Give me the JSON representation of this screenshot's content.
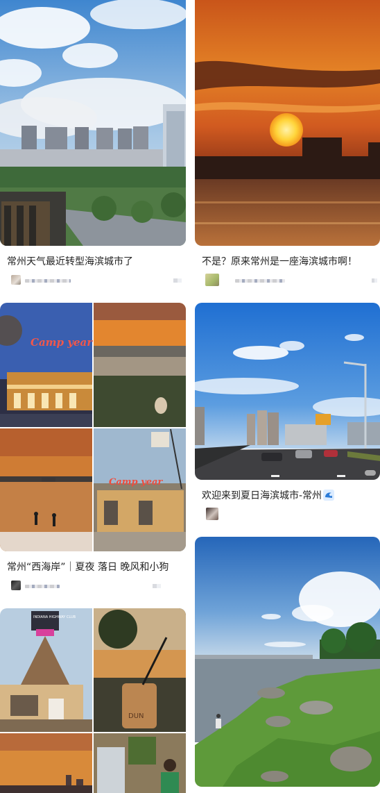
{
  "feed": {
    "left": [
      {
        "title": "常州天气最近转型海滨城市了",
        "image": "city-skyline-cloudy-sky-photo"
      },
      {
        "title": "常州“西海岸”｜夏夜 落日 晚风和小狗",
        "image": "collage-camp-yeah-sunset-dog-wakeboard",
        "sign_text_1": "Camp year",
        "sign_text_2": "Camp year"
      },
      {
        "image": "collage-indiana-highway-club-coffee-sunset",
        "sign_text": "INDIANA HIGHWAY CLUB",
        "cup_text": "DUN"
      }
    ],
    "right": [
      {
        "title": "不是？原来常州是一座海滨城市啊！",
        "image": "sunset-over-water-photo"
      },
      {
        "title": "欢迎来到夏日海滨城市-常州",
        "title_icon": "wave-icon",
        "image": "highway-blue-sky-photo"
      },
      {
        "image": "lakeside-grass-rocks-photo"
      }
    ]
  },
  "colors": {
    "title_text": "#222222",
    "background": "#ffffff"
  }
}
